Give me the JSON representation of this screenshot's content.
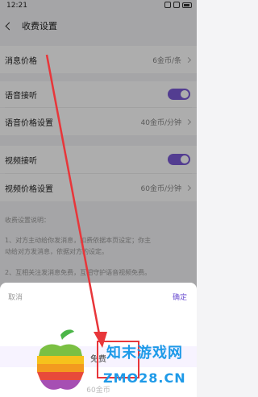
{
  "status_bar": {
    "time": "12:21"
  },
  "header": {
    "title": "收费设置"
  },
  "rows": [
    {
      "label": "消息价格",
      "value": "6金币/条"
    },
    {
      "label": "语音接听",
      "toggle": true
    },
    {
      "label": "语音价格设置",
      "value": "40金币/分钟"
    },
    {
      "label": "视频接听",
      "toggle": true
    },
    {
      "label": "视频价格设置",
      "value": "60金币/分钟"
    }
  ],
  "explain": {
    "title": "收费设置说明：",
    "line1": "1、对方主动给你发消息，扣费依据本页设定；你主",
    "line2": "动给对方发消息，依据对方的设定。",
    "line3": "2、互相关注发消息免费，互相守护语音视频免费。"
  },
  "sheet": {
    "cancel": "取消",
    "confirm": "确定",
    "selected": "免费",
    "next": "60金币"
  },
  "watermark": {
    "cn": "知末游戏网",
    "en": "ZMO28.CN"
  },
  "colors": {
    "accent": "#7b5bd6",
    "annotation": "#e8363a",
    "watermark": "#1e9ae8"
  }
}
